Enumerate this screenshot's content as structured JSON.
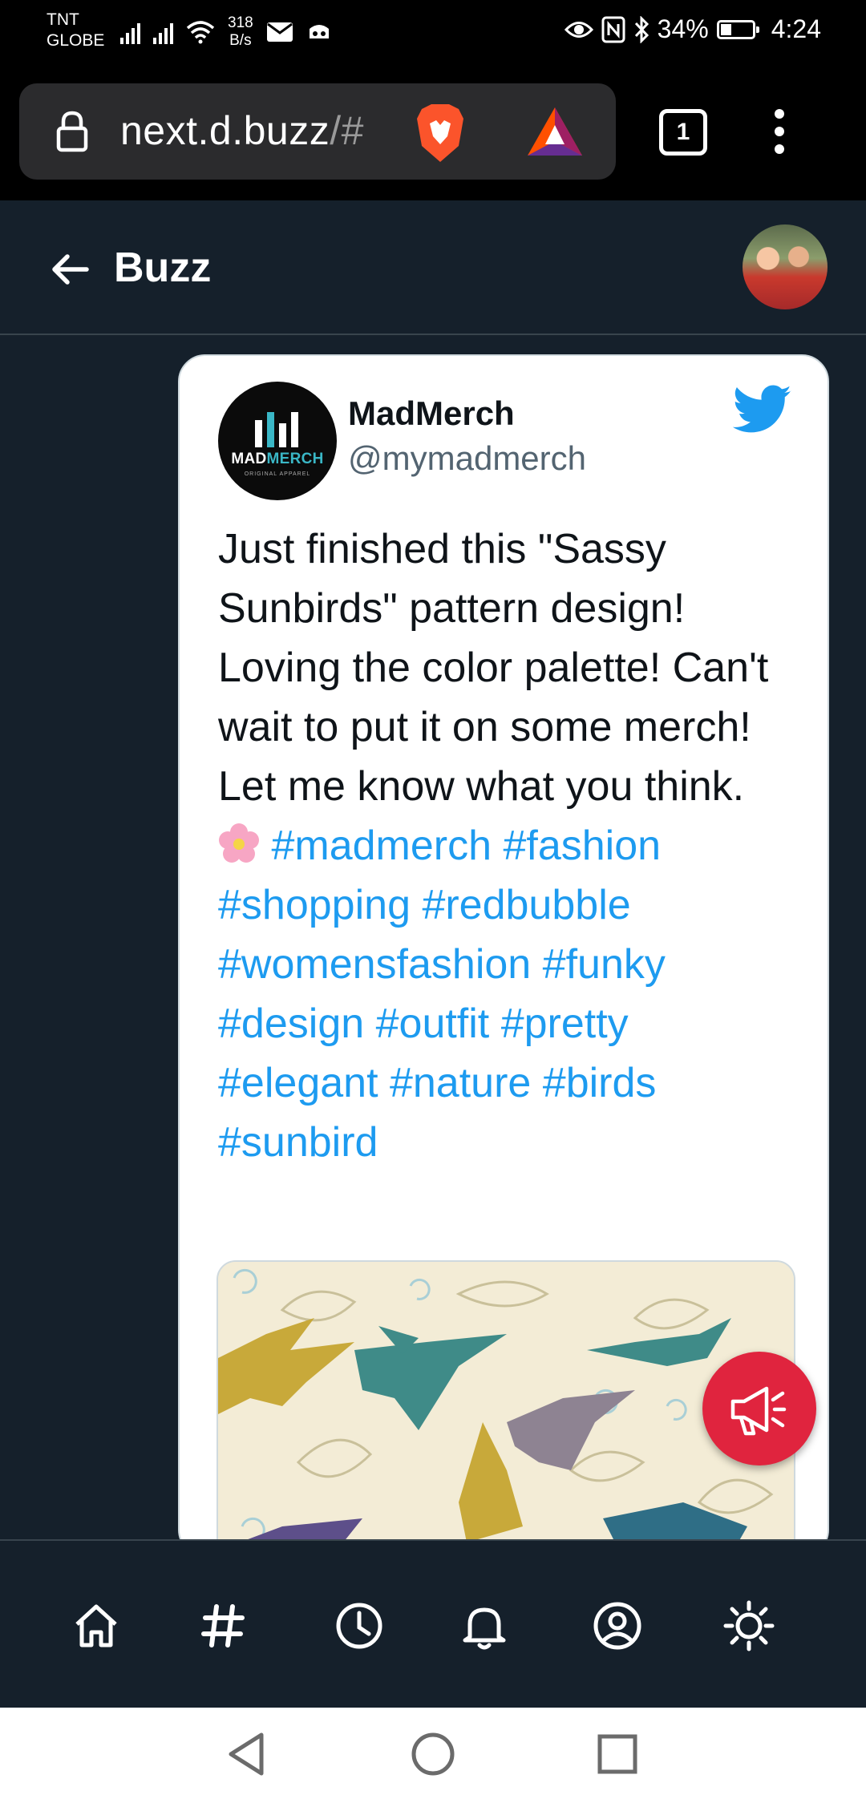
{
  "status_bar": {
    "carrier_line1": "TNT",
    "carrier_line2": "GLOBE",
    "speed_value": "318",
    "speed_unit": "B/s",
    "battery": "34%",
    "battery_level": 0.34,
    "time": "4:24",
    "icons": [
      "signal-icon",
      "signal-icon",
      "wifi-icon",
      "mail-icon",
      "app-icon",
      "eye-icon",
      "nfc-icon",
      "bluetooth-icon",
      "battery-icon"
    ]
  },
  "browser": {
    "url_main": "next.d.buzz",
    "url_suffix": "/#",
    "tab_count": "1",
    "icons": [
      "lock-icon",
      "brave-lion-icon",
      "bat-triangle-icon",
      "tabs-icon",
      "more-menu-icon"
    ]
  },
  "header": {
    "title": "Buzz",
    "icons": [
      "back-arrow-icon",
      "profile-avatar"
    ]
  },
  "tweet": {
    "display_name": "MadMerch",
    "handle": "@mymadmerch",
    "logo_text_1": "MAD",
    "logo_text_2": "MERCH",
    "logo_subtitle": "ORIGINAL APPAREL",
    "body_text": "Just finished this \"Sassy Sunbirds\" pattern design! Loving the color palette! Can't wait to put it on some merch! Let me know what you think. ",
    "hashtags_line1": "#madmerch",
    "hashtags_rest": "#fashion #shopping #redbubble #womensfashion  #funky #design #outfit #pretty #elegant #nature #birds #sunbird",
    "source_icon": "twitter-bird-icon",
    "accent_color": "#1d9bf0"
  },
  "fab": {
    "icon": "megaphone-icon",
    "color": "#e0243e"
  },
  "bottom_nav": {
    "items": [
      "home-icon",
      "hashtag-icon",
      "clock-icon",
      "bell-icon",
      "profile-icon",
      "theme-icon"
    ]
  },
  "system_nav": {
    "items": [
      "back-triangle-icon",
      "home-circle-icon",
      "recents-square-icon"
    ]
  },
  "colors": {
    "background": "#15202b",
    "card": "#ffffff",
    "divider": "#38444d"
  }
}
